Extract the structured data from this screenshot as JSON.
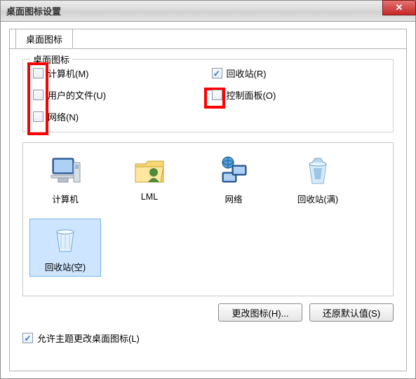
{
  "window": {
    "title": "桌面图标设置",
    "close_glyph": "✕"
  },
  "tab": {
    "label": "桌面图标"
  },
  "fieldset": {
    "legend": "桌面图标",
    "items": [
      {
        "label": "计算机(M)",
        "checked": false,
        "highlighted": true
      },
      {
        "label": "回收站(R)",
        "checked": true,
        "highlighted": false
      },
      {
        "label": "用户的文件(U)",
        "checked": false,
        "highlighted": true
      },
      {
        "label": "控制面板(O)",
        "checked": false,
        "highlighted": true
      },
      {
        "label": "网络(N)",
        "checked": false,
        "highlighted": true
      }
    ]
  },
  "preview": {
    "items": [
      {
        "label": "计算机",
        "icon": "computer-icon",
        "selected": false
      },
      {
        "label": "LML",
        "icon": "user-folder-icon",
        "selected": false
      },
      {
        "label": "网络",
        "icon": "network-icon",
        "selected": false
      },
      {
        "label": "回收站(满)",
        "icon": "recycle-full-icon",
        "selected": false
      },
      {
        "label": "回收站(空)",
        "icon": "recycle-empty-icon",
        "selected": true
      }
    ]
  },
  "buttons": {
    "change_icon": "更改图标(H)...",
    "restore_default": "还原默认值(S)"
  },
  "theme_checkbox": {
    "label": "允许主题更改桌面图标(L)",
    "checked": true
  }
}
